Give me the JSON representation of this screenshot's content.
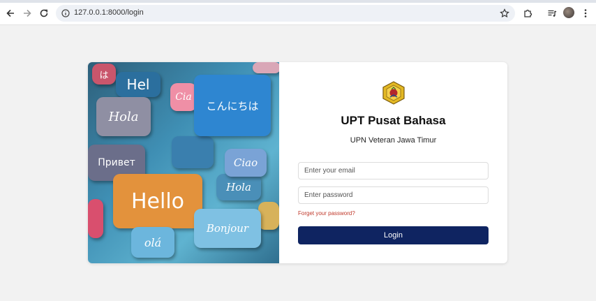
{
  "browser": {
    "url": "127.0.0.1:8000/login",
    "icons": {
      "back": "arrow-left-icon",
      "forward": "arrow-right-icon",
      "reload": "reload-icon",
      "site_info": "info-icon",
      "bookmark": "star-icon",
      "extensions": "puzzle-icon",
      "media": "media-controls-icon",
      "profile": "avatar",
      "menu": "kebab-menu-icon"
    }
  },
  "hero": {
    "bubbles": {
      "hello": "Hello",
      "konnichiwa": "こんにちは",
      "hola": "Hola",
      "privet": "Привет",
      "ciao": "Ciao",
      "ciao_small": "Cia",
      "bonjour": "Bonjour",
      "ola": "olá",
      "hola2": "Hola",
      "hel": "Hel",
      "ha": "は"
    }
  },
  "login": {
    "logo": "university-emblem",
    "title": "UPT Pusat Bahasa",
    "subtitle": "UPN Veteran Jawa Timur",
    "email_placeholder": "Enter your email",
    "password_placeholder": "Enter password",
    "forgot_label": "Forget your password?",
    "submit_label": "Login"
  },
  "colors": {
    "primary_button": "#0f2461",
    "forgot_link": "#c0392b",
    "page_background": "#f2f2f2"
  }
}
